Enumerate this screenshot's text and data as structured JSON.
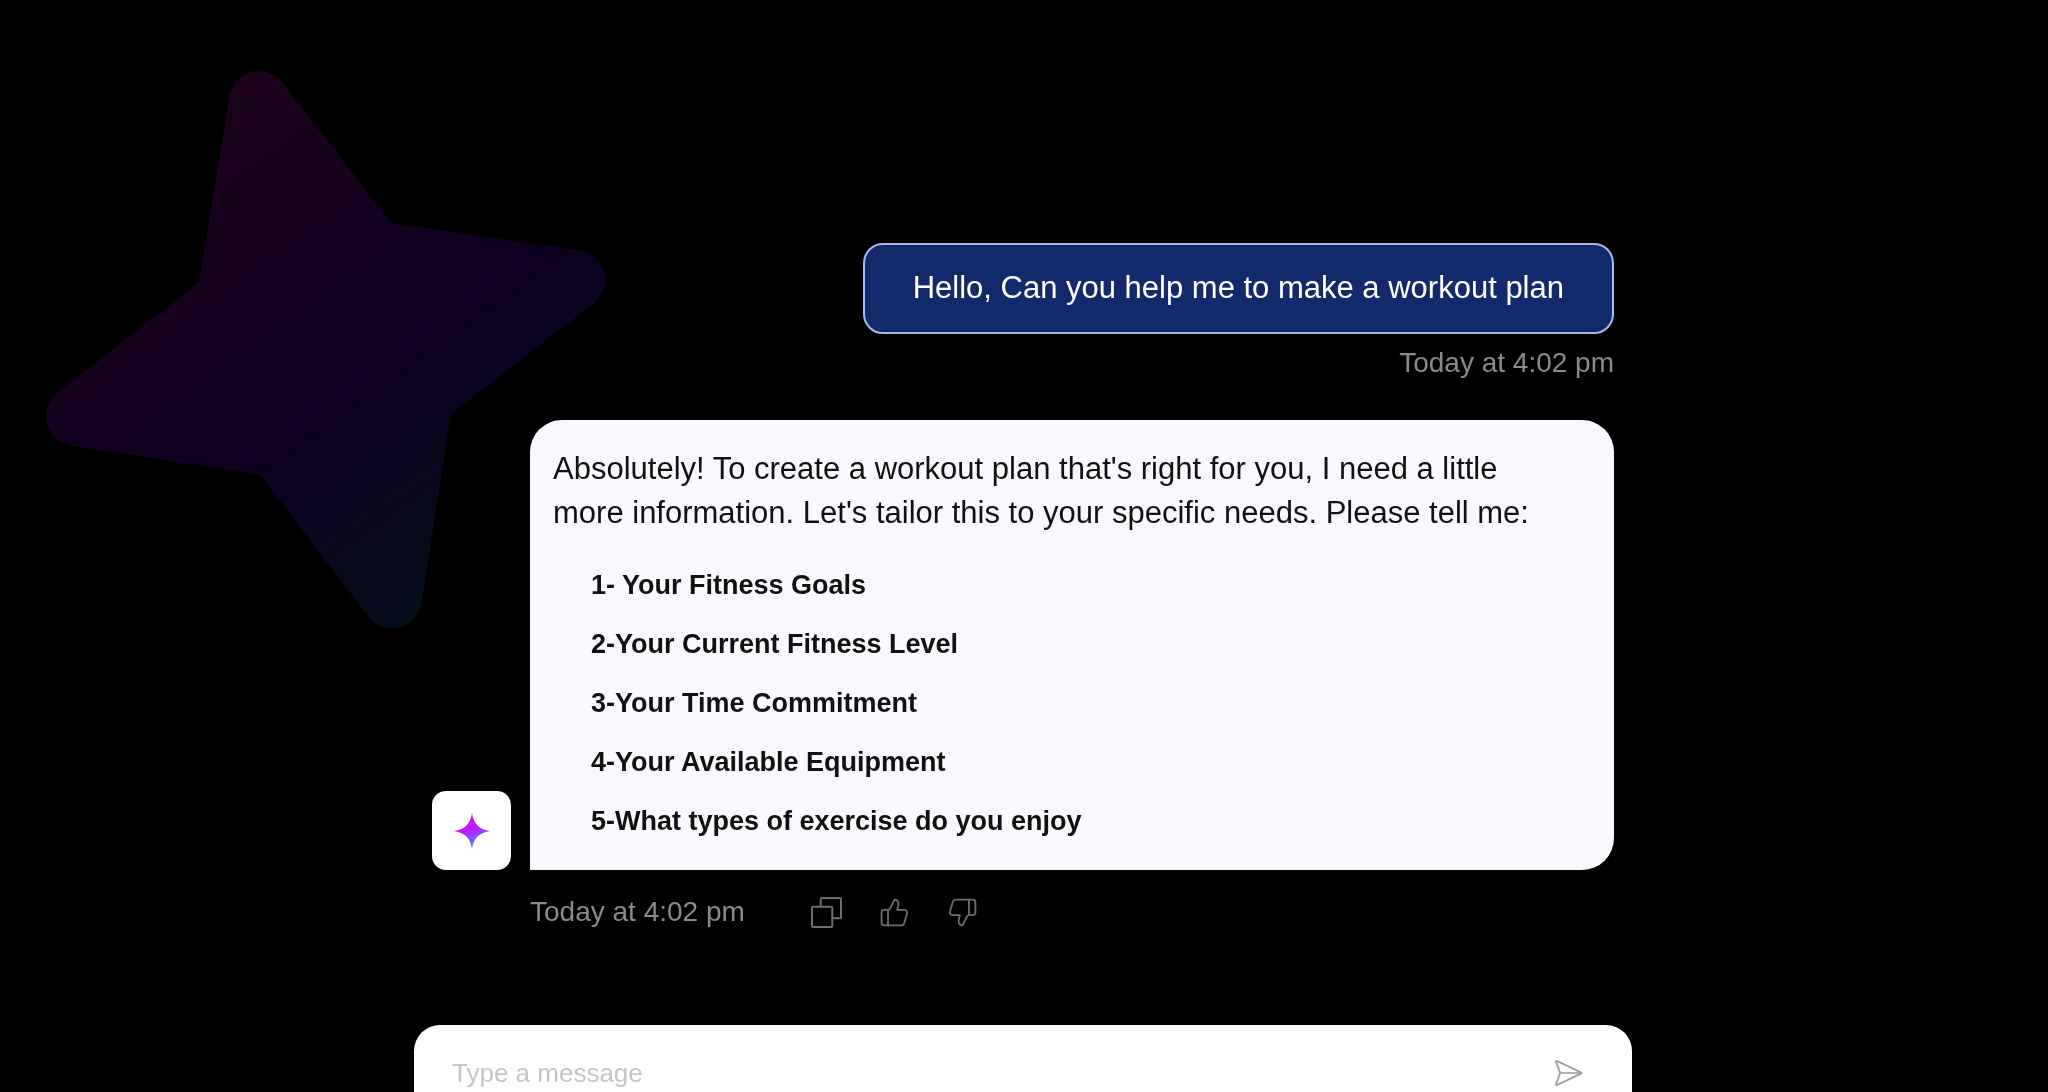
{
  "conversation": {
    "messages": [
      {
        "kind": "user",
        "text": "Hello, Can you help me to make a workout plan",
        "time": "Today at 4:02 pm"
      },
      {
        "kind": "assistant",
        "text": "Absolutely! To create a workout plan that's right for you, I need a little more information. Let's tailor this to your specific needs. Please tell me:",
        "list": [
          "1- Your Fitness Goals",
          "2-Your Current Fitness Level",
          "3-Your Time Commitment",
          "4-Your Available Equipment",
          "5-What types of exercise do you enjoy"
        ],
        "time": "Today at 4:02 pm"
      }
    ]
  },
  "composer": {
    "placeholder": "Type a message"
  }
}
